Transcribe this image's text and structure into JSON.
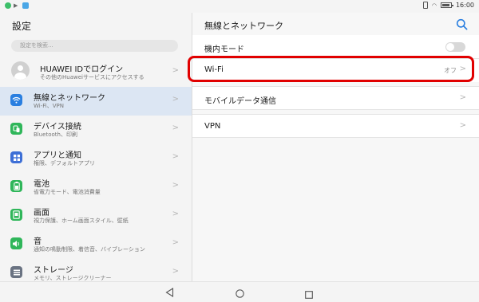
{
  "status": {
    "time": "16:00",
    "notification_icons": [
      "green-dot-icon",
      "arrow-icon",
      "blue-app-icon"
    ],
    "right_icons": [
      "vibrate-icon",
      "wifi-icon",
      "battery-icon"
    ]
  },
  "left": {
    "title": "設定",
    "search_placeholder": "設定を検索...",
    "account": {
      "title": "HUAWEI IDでログイン",
      "subtitle": "その他のHuaweiサービスにアクセスする"
    },
    "items": [
      {
        "title": "無線とネットワーク",
        "subtitle": "Wi-Fi、VPN",
        "icon": "wifi-icon",
        "color": "#2a7fe0"
      },
      {
        "title": "デバイス接続",
        "subtitle": "Bluetooth、印刷",
        "icon": "device-connect-icon",
        "color": "#2fb65a"
      },
      {
        "title": "アプリと通知",
        "subtitle": "権限、デフォルトアプリ",
        "icon": "apps-icon",
        "color": "#3d6fd6"
      },
      {
        "title": "電池",
        "subtitle": "省電力モード、電池消費量",
        "icon": "battery-icon",
        "color": "#2fb65a"
      },
      {
        "title": "画面",
        "subtitle": "視力保護、ホーム画面スタイル、壁紙",
        "icon": "display-icon",
        "color": "#2fb65a"
      },
      {
        "title": "音",
        "subtitle": "通知の鳴動制限、着信音、バイブレーション",
        "icon": "sound-icon",
        "color": "#2fb65a"
      },
      {
        "title": "ストレージ",
        "subtitle": "メモリ、ストレージクリーナー",
        "icon": "storage-icon",
        "color": "#6a7382"
      }
    ]
  },
  "right": {
    "title": "無線とネットワーク",
    "rows": {
      "airplane": {
        "label": "機内モード",
        "enabled": false
      },
      "wifi": {
        "label": "Wi-Fi",
        "value": "オフ"
      },
      "mobile_data": {
        "label": "モバイルデータ通信"
      },
      "vpn": {
        "label": "VPN"
      }
    },
    "accent_color": "#2a7fe0",
    "highlight_color": "#e10000"
  },
  "nav": {
    "icons": [
      "back-icon",
      "home-icon",
      "recent-apps-icon"
    ]
  }
}
